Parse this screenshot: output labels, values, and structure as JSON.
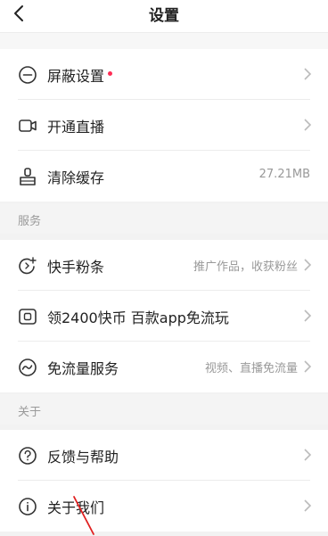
{
  "nav": {
    "title": "设置"
  },
  "rows_top": [
    {
      "label": "屏蔽设置",
      "value": "",
      "icon": "block-circle-icon",
      "has_dot": true
    },
    {
      "label": "开通直播",
      "value": "",
      "icon": "video-camera-icon",
      "has_dot": false
    },
    {
      "label": "清除缓存",
      "value": "27.21MB",
      "icon": "broom-icon",
      "has_dot": false
    }
  ],
  "section_services": {
    "label": "服务"
  },
  "rows_services": [
    {
      "label": "快手粉条",
      "hint": "推广作品，收获粉丝",
      "icon": "fan-tiao-icon"
    },
    {
      "label": "领2400快币 百款app免流玩",
      "hint": "",
      "icon": "coin-icon"
    },
    {
      "label": "免流量服务",
      "hint": "视频、直播免流量",
      "icon": "traffic-wave-icon"
    }
  ],
  "section_about": {
    "label": "关于"
  },
  "rows_about": [
    {
      "label": "反馈与帮助",
      "icon": "question-circle-icon"
    },
    {
      "label": "关于我们",
      "icon": "info-circle-icon"
    }
  ],
  "colors": {
    "accent_dot": "#ff2d55",
    "annotation": "#e02020"
  }
}
